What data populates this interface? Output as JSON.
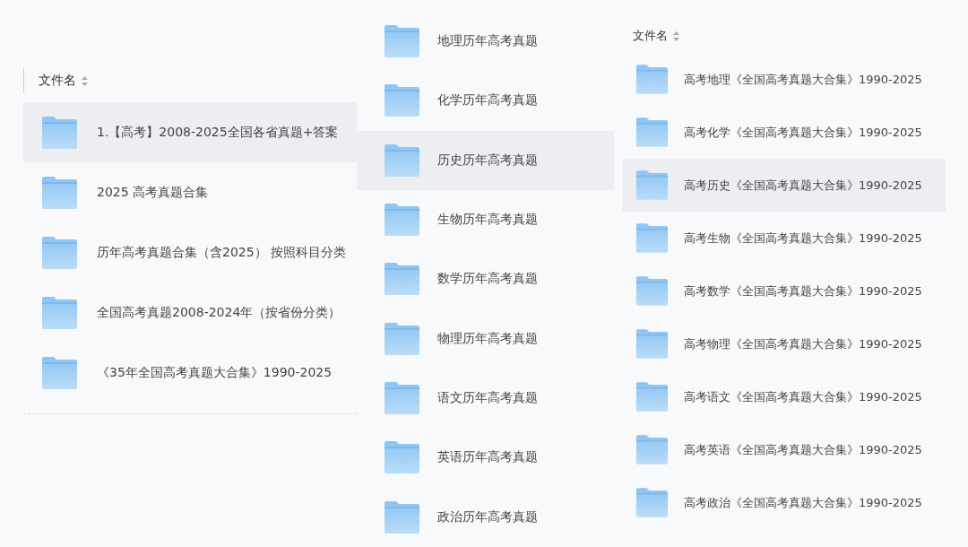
{
  "panels": [
    {
      "header": "文件名",
      "divider": true,
      "rows": [
        {
          "name": "1.【高考】2008-2025全国各省真题+答案",
          "selected": true
        },
        {
          "name": "2025 高考真题合集",
          "selected": false
        },
        {
          "name": "历年高考真题合集（含2025）  按照科目分类",
          "selected": false
        },
        {
          "name": "全国高考真题2008-2024年（按省份分类）",
          "selected": false
        },
        {
          "name": "《35年全国高考真题大合集》1990-2025",
          "selected": false
        }
      ]
    },
    {
      "rows": [
        {
          "name": "地理历年高考真题",
          "selected": false
        },
        {
          "name": "化学历年高考真题",
          "selected": false
        },
        {
          "name": "历史历年高考真题",
          "selected": true
        },
        {
          "name": "生物历年高考真题",
          "selected": false
        },
        {
          "name": "数学历年高考真题",
          "selected": false
        },
        {
          "name": "物理历年高考真题",
          "selected": false
        },
        {
          "name": "语文历年高考真题",
          "selected": false
        },
        {
          "name": "英语历年高考真题",
          "selected": false
        },
        {
          "name": "政治历年高考真题",
          "selected": false
        }
      ]
    },
    {
      "header": "文件名",
      "rows": [
        {
          "name": "高考地理《全国高考真题大合集》1990-2025",
          "selected": false
        },
        {
          "name": "高考化学《全国高考真题大合集》1990-2025",
          "selected": false
        },
        {
          "name": "高考历史《全国高考真题大合集》1990-2025",
          "selected": true
        },
        {
          "name": "高考生物《全国高考真题大合集》1990-2025",
          "selected": false
        },
        {
          "name": "高考数学《全国高考真题大合集》1990-2025",
          "selected": false
        },
        {
          "name": "高考物理《全国高考真题大合集》1990-2025",
          "selected": false
        },
        {
          "name": "高考语文《全国高考真题大合集》1990-2025",
          "selected": false
        },
        {
          "name": "高考英语《全国高考真题大合集》1990-2025",
          "selected": false
        },
        {
          "name": "高考政治《全国高考真题大合集》1990-2025",
          "selected": false
        }
      ]
    }
  ]
}
